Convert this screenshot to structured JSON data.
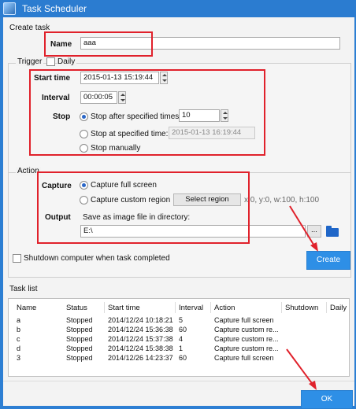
{
  "window": {
    "title": "Task Scheduler"
  },
  "create_task": {
    "heading": "Create task",
    "name_label": "Name",
    "name_value": "aaa"
  },
  "trigger": {
    "heading": "Trigger",
    "daily_label": "Daily",
    "start_time_label": "Start time",
    "start_time_value": "2015-01-13 15:19:44",
    "interval_label": "Interval",
    "interval_value": "00:00:05",
    "stop_label": "Stop",
    "stop_after_label": "Stop after specified times:",
    "stop_after_value": "10",
    "stop_at_label": "Stop at specified time:",
    "stop_at_value": "2015-01-13 16:19:44",
    "stop_manually_label": "Stop manually"
  },
  "action": {
    "heading": "Action",
    "capture_label": "Capture",
    "capture_full_label": "Capture full screen",
    "capture_custom_label": "Capture custom region",
    "select_region_label": "Select region",
    "region_text": "x:0, y:0, w:100, h:100",
    "output_label": "Output",
    "save_label": "Save as image file in directory:",
    "directory_value": "E:\\",
    "browse_label": "..."
  },
  "shutdown_label": "Shutdown computer when task completed",
  "create_button_label": "Create",
  "task_list": {
    "heading": "Task list",
    "columns": [
      "Name",
      "Status",
      "Start time",
      "Interval",
      "Action",
      "Shutdown",
      "Daily"
    ],
    "rows": [
      [
        "a",
        "Stopped",
        "2014/12/24 10:18:21",
        "5",
        "Capture full screen",
        "",
        ""
      ],
      [
        "b",
        "Stopped",
        "2014/12/24 15:36:38",
        "60",
        "Capture custom re...",
        "",
        ""
      ],
      [
        "c",
        "Stopped",
        "2014/12/24 15:37:38",
        "4",
        "Capture custom re...",
        "",
        ""
      ],
      [
        "d",
        "Stopped",
        "2014/12/24 15:38:38",
        "1",
        "Capture custom re...",
        "",
        ""
      ],
      [
        "3",
        "Stopped",
        "2014/12/26 14:23:37",
        "60",
        "Capture full screen",
        "",
        ""
      ]
    ]
  },
  "ok_button_label": "OK",
  "colors": {
    "titlebar": "#2b7cd0",
    "accent_button": "#2e8fe6",
    "highlight": "#e0212b",
    "arrow": "#e0212b"
  }
}
